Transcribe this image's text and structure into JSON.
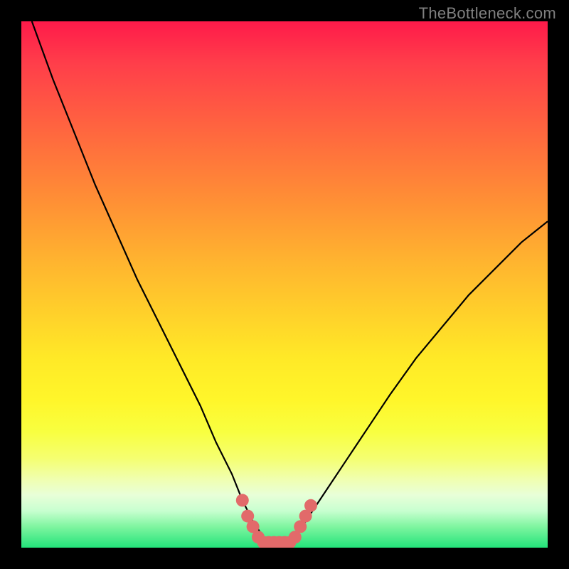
{
  "watermark": {
    "text": "TheBottleneck.com"
  },
  "chart_data": {
    "type": "line",
    "title": "",
    "xlabel": "",
    "ylabel": "",
    "xlim": [
      0,
      100
    ],
    "ylim": [
      0,
      100
    ],
    "grid": false,
    "series": [
      {
        "name": "bottleneck-curve",
        "x": [
          2,
          6,
          10,
          14,
          18,
          22,
          26,
          30,
          34,
          37,
          40,
          42,
          44,
          46,
          48,
          50,
          52,
          54,
          58,
          62,
          66,
          70,
          75,
          80,
          85,
          90,
          95,
          100
        ],
        "values": [
          100,
          89,
          79,
          69,
          60,
          51,
          43,
          35,
          27,
          20,
          14,
          9,
          5,
          2,
          1,
          1,
          2,
          5,
          11,
          17,
          23,
          29,
          36,
          42,
          48,
          53,
          58,
          62
        ]
      }
    ],
    "markers": {
      "name": "sweet-spot",
      "color": "#e26a6a",
      "points": [
        {
          "x": 42,
          "y": 9
        },
        {
          "x": 43,
          "y": 6
        },
        {
          "x": 44,
          "y": 4
        },
        {
          "x": 45,
          "y": 2
        },
        {
          "x": 46,
          "y": 1
        },
        {
          "x": 47,
          "y": 1
        },
        {
          "x": 48,
          "y": 1
        },
        {
          "x": 49,
          "y": 1
        },
        {
          "x": 50,
          "y": 1
        },
        {
          "x": 51,
          "y": 1
        },
        {
          "x": 52,
          "y": 2
        },
        {
          "x": 53,
          "y": 4
        },
        {
          "x": 54,
          "y": 6
        },
        {
          "x": 55,
          "y": 8
        }
      ]
    },
    "background_gradient": {
      "top": "#ff1a4a",
      "mid": "#fff62a",
      "bottom": "#23e37a"
    }
  }
}
